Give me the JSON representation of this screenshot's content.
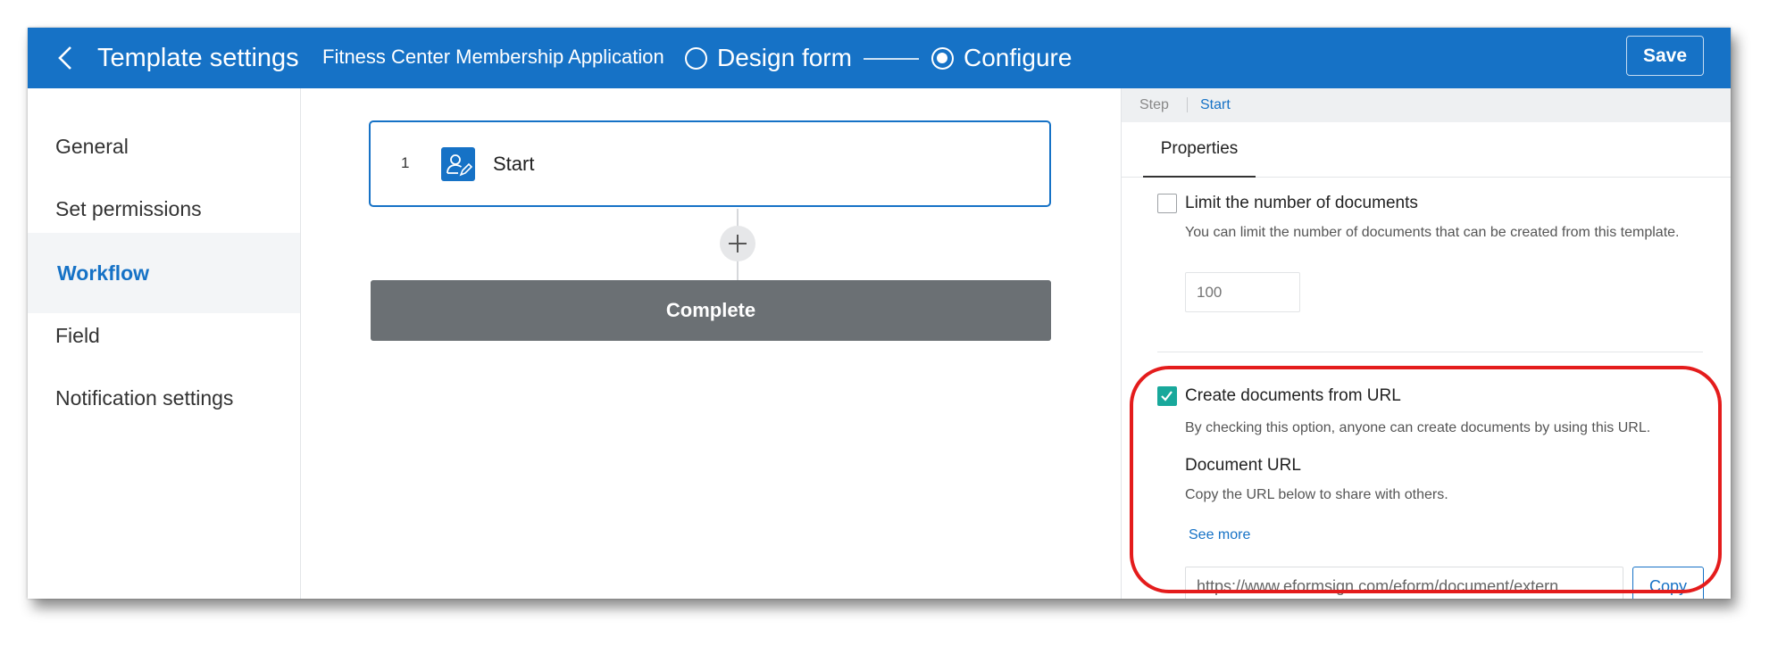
{
  "header": {
    "title": "Template settings",
    "form_name": "Fitness Center Membership Application",
    "steps": [
      {
        "label": "Design form",
        "selected": false
      },
      {
        "label": "Configure",
        "selected": true
      }
    ],
    "save_label": "Save",
    "brand_color": "#1672c6"
  },
  "sidebar": {
    "items": [
      {
        "label": "General",
        "active": false
      },
      {
        "label": "Set permissions",
        "active": false
      },
      {
        "label": "Workflow",
        "active": true
      },
      {
        "label": "Field",
        "active": false
      },
      {
        "label": "Notification settings",
        "active": false
      }
    ]
  },
  "workflow": {
    "step": {
      "number": "1",
      "name": "Start",
      "icon": "user-edit-icon"
    },
    "add_icon": "plus-icon",
    "complete_label": "Complete"
  },
  "panel": {
    "breadcrumb": {
      "step": "Step",
      "current": "Start"
    },
    "tab": "Properties",
    "limit": {
      "checked": false,
      "title": "Limit the number of documents",
      "description": "You can limit the number of documents that can be created from this template.",
      "placeholder": "100"
    },
    "url_option": {
      "checked": true,
      "title": "Create documents from URL",
      "description": "By checking this option, anyone can create documents by using this URL.",
      "doc_url_label": "Document URL",
      "copy_hint": "Copy the URL below to share with others.",
      "see_more": "See more",
      "url_value": "https://www.eformsign.com/eform/document/extern…",
      "copy_label": "Copy"
    }
  },
  "colors": {
    "accent": "#1672c6",
    "checkbox_checked": "#18a89b",
    "complete_block": "#6b7074",
    "highlight": "#e41c1c"
  }
}
